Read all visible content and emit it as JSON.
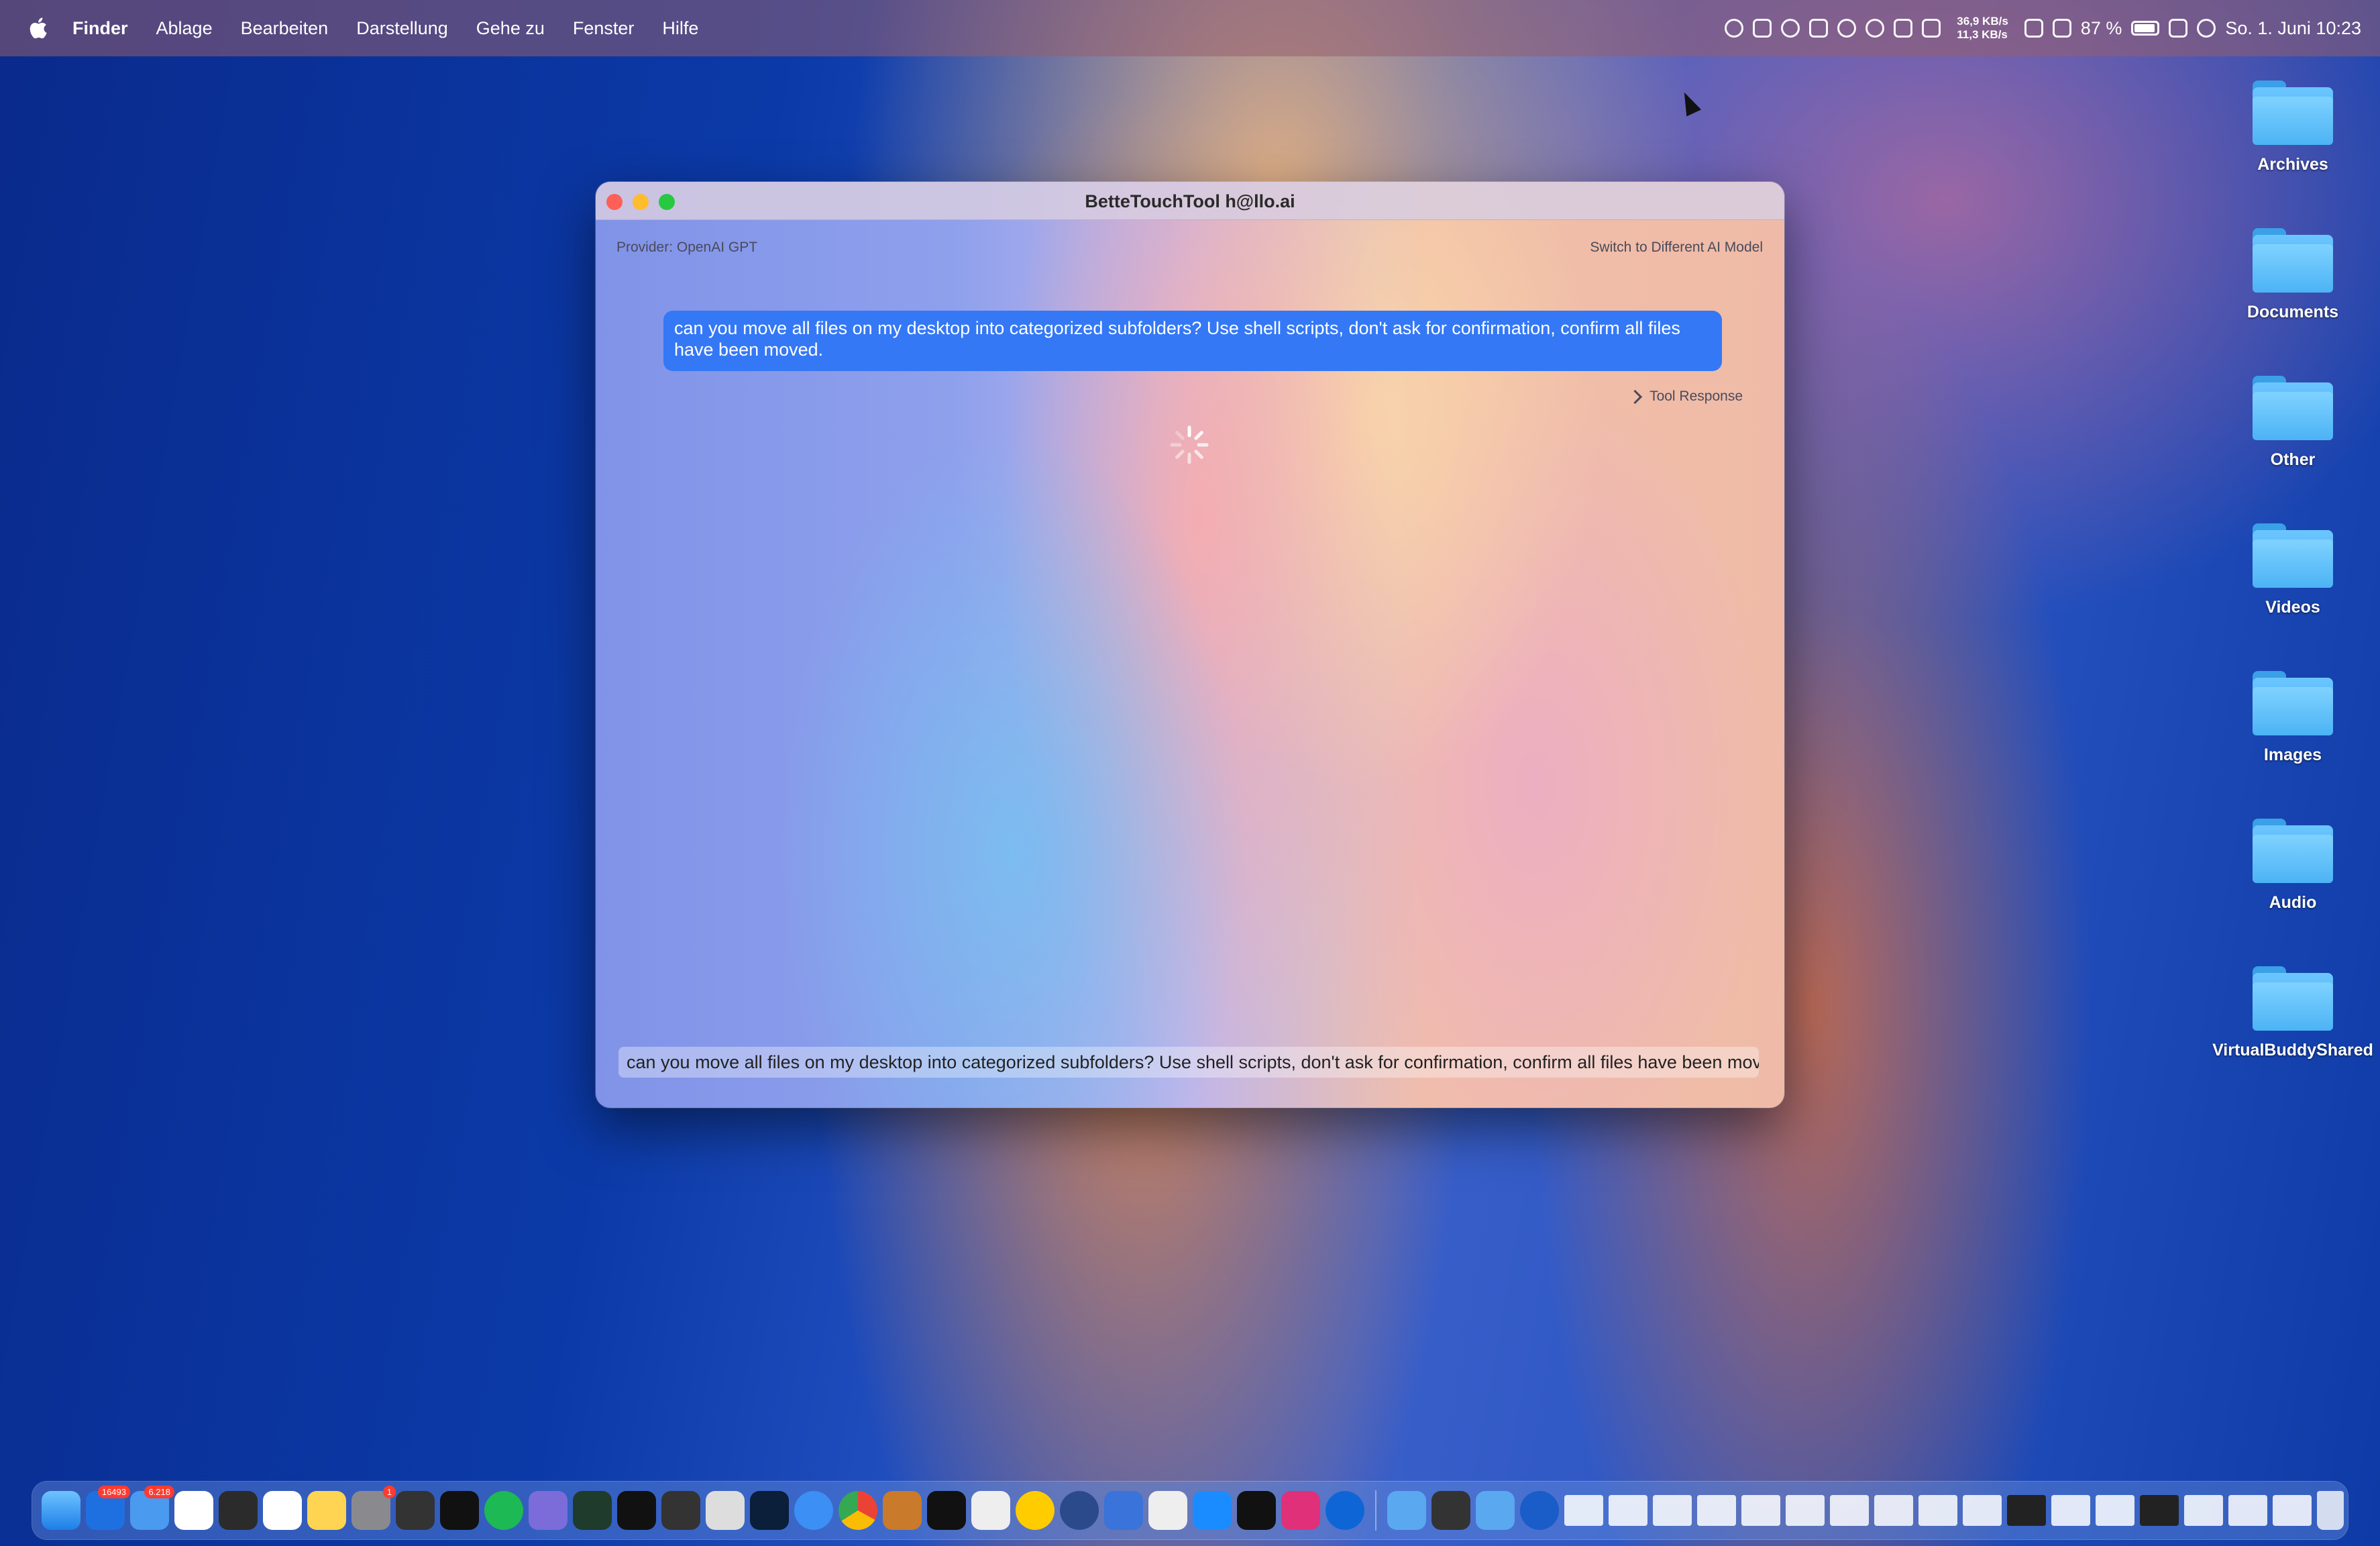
{
  "menubar": {
    "app": "Finder",
    "items": [
      "Ablage",
      "Bearbeiten",
      "Darstellung",
      "Gehe zu",
      "Fenster",
      "Hilfe"
    ],
    "net_up": "36,9 KB/s",
    "net_down": "11,3 KB/s",
    "battery": "87 %",
    "datetime": "So. 1. Juni  10:23"
  },
  "window": {
    "title": "BetteTouchTool h@llo.ai",
    "provider": "Provider: OpenAI GPT",
    "switch_model": "Switch to Different AI Model",
    "user_message": "can you move all files on my desktop into categorized subfolders? Use shell scripts, don't ask for confirmation, confirm all files have been moved.",
    "tool_response": "Tool Response",
    "input_value": "can you move all files on my desktop into categorized subfolders? Use shell scripts, don't ask for confirmation, confirm all files have been moved."
  },
  "desktop": {
    "folders": [
      "Archives",
      "Documents",
      "Other",
      "Videos",
      "Images",
      "Audio",
      "VirtualBuddyShared"
    ]
  },
  "dock": {
    "badges": {
      "mail1": "16493",
      "mail2": "6.218",
      "settings": "1"
    }
  },
  "colors": {
    "bubble": "#3478f6",
    "close": "#fe5f57",
    "minimize": "#febc2e",
    "maximize": "#28c840"
  }
}
